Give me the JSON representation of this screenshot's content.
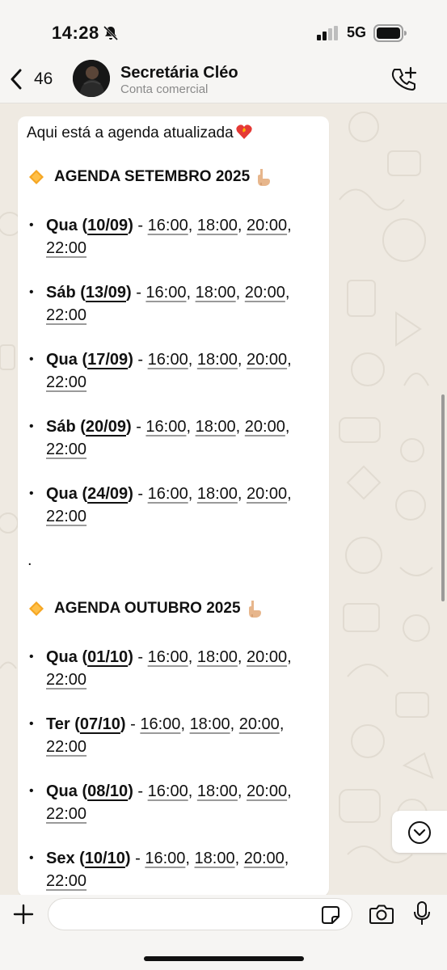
{
  "status_bar": {
    "time": "14:28",
    "network": "5G"
  },
  "header": {
    "back_count": "46",
    "contact_name": "Secretária Cléo",
    "contact_subtitle": "Conta comercial"
  },
  "message": {
    "intro": "Aqui está a agenda atualizada",
    "september": {
      "title": "AGENDA SETEMBRO 2025",
      "entries": [
        {
          "day": "Qua",
          "date": "10/09",
          "times": [
            "16:00",
            "18:00",
            "20:00",
            "22:00"
          ]
        },
        {
          "day": "Sáb",
          "date": "13/09",
          "times": [
            "16:00",
            "18:00",
            "20:00",
            "22:00"
          ]
        },
        {
          "day": "Qua",
          "date": "17/09",
          "times": [
            "16:00",
            "18:00",
            "20:00",
            "22:00"
          ]
        },
        {
          "day": "Sáb",
          "date": "20/09",
          "times": [
            "16:00",
            "18:00",
            "20:00",
            "22:00"
          ]
        },
        {
          "day": "Qua",
          "date": "24/09",
          "times": [
            "16:00",
            "18:00",
            "20:00",
            "22:00"
          ]
        }
      ]
    },
    "separator": ".",
    "october": {
      "title": "AGENDA OUTUBRO 2025",
      "entries": [
        {
          "day": "Qua",
          "date": "01/10",
          "times": [
            "16:00",
            "18:00",
            "20:00",
            "22:00"
          ]
        },
        {
          "day": "Ter",
          "date": "07/10",
          "times": [
            "16:00",
            "18:00",
            "20:00",
            "22:00"
          ]
        },
        {
          "day": "Qua",
          "date": "08/10",
          "times": [
            "16:00",
            "18:00",
            "20:00",
            "22:00"
          ]
        },
        {
          "day": "Sex",
          "date": "10/10",
          "times": [
            "16:00",
            "18:00",
            "20:00",
            "22:00"
          ]
        }
      ]
    }
  },
  "composer": {
    "placeholder": ""
  },
  "icons": {
    "back": "chevron-left-icon",
    "call": "phone-plus-icon",
    "heading_marker": "orange-diamond-icon",
    "heading_pointer": "pointing-down-icon",
    "intro_emoji": "heart-on-fire-icon",
    "scroll_down": "chevron-down-circle-icon",
    "plus": "plus-icon",
    "sticker": "sticker-icon",
    "camera": "camera-icon",
    "mic": "microphone-icon"
  },
  "colors": {
    "chat_background": "#efeae2",
    "bubble": "#ffffff",
    "bar": "#f6f5f3",
    "diamond": "#f5a623"
  }
}
